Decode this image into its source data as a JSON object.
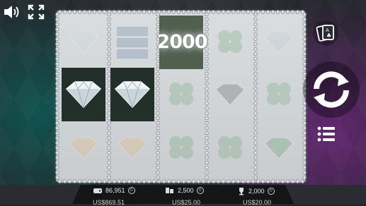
{
  "topbar": {
    "sound_icon": "speaker-icon",
    "fullscreen_icon": "fullscreen-icon"
  },
  "reels": {
    "win_amount": "2000",
    "columns": [
      {
        "symbols": [
          "diamond",
          "diamond",
          "gold-diamond"
        ],
        "highlight": [
          false,
          true,
          false
        ]
      },
      {
        "symbols": [
          "bonus",
          "diamond",
          "gold-diamond"
        ],
        "highlight": [
          false,
          true,
          false
        ]
      },
      {
        "symbols": [
          "clover",
          "clover",
          "clover"
        ],
        "highlight": [
          true,
          false,
          false
        ]
      },
      {
        "symbols": [
          "clover",
          "diamond",
          "clover"
        ],
        "highlight": [
          false,
          false,
          false
        ]
      },
      {
        "symbols": [
          "diamond",
          "clover",
          "green-diamond"
        ],
        "highlight": [
          false,
          false,
          false
        ]
      }
    ]
  },
  "controls": {
    "cards_icon": "playing-cards-icon",
    "spin_icon": "spin-arrows-icon",
    "menu_icon": "menu-icon"
  },
  "bottom": {
    "balance_coins": "86,951",
    "balance_money": "US$869.51",
    "bet_coins": "2,500",
    "bet_money": "US$25.00",
    "win_coins": "2,000",
    "win_money": "US$20.00",
    "coin_symbol": "©"
  }
}
